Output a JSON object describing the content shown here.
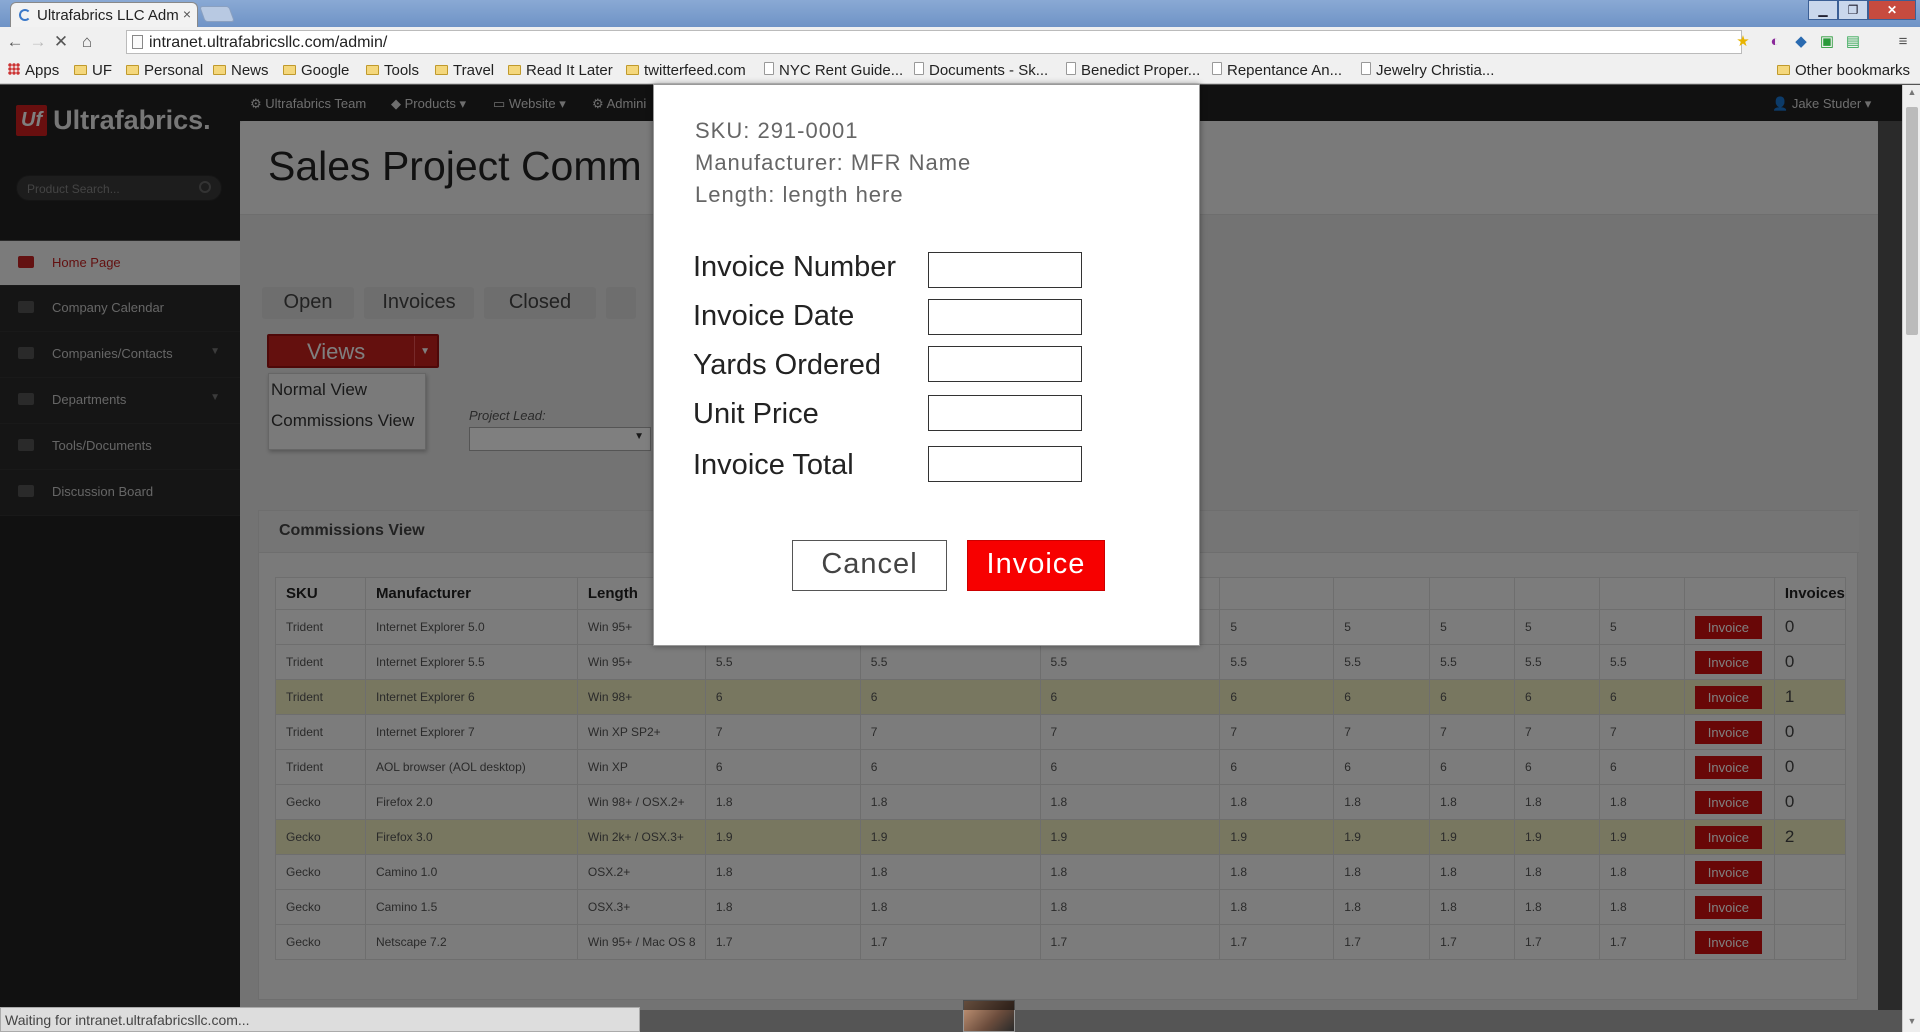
{
  "browser": {
    "tab_title": "Ultrafabrics LLC Adm",
    "url": "intranet.ultrafabricsllc.com/admin/",
    "bookmarks": [
      "Apps",
      "UF",
      "Personal",
      "News",
      "Google",
      "Tools",
      "Travel",
      "Read It Later",
      "twitterfeed.com",
      "NYC Rent Guide...",
      "Documents - Sk...",
      "Benedict Proper...",
      "Repentance An...",
      "Jewelry Christia..."
    ],
    "other_bookmarks": "Other bookmarks",
    "status": "Waiting for intranet.ultrafabricsllc.com..."
  },
  "topnav": {
    "items": [
      "Ultrafabrics Team",
      "Products",
      "Website",
      "Admini"
    ],
    "user": "Jake Studer"
  },
  "sidebar": {
    "logo_mark": "Uf",
    "logo_text": "Ultrafabrics.",
    "search_placeholder": "Product Search...",
    "items": [
      {
        "label": "Home Page"
      },
      {
        "label": "Company Calendar"
      },
      {
        "label": "Companies/Contacts"
      },
      {
        "label": "Departments"
      },
      {
        "label": "Tools/Documents"
      },
      {
        "label": "Discussion Board"
      }
    ]
  },
  "main": {
    "title": "Sales Project Comm",
    "tabs": [
      "Open",
      "Invoices",
      "Closed"
    ],
    "views_button": "Views",
    "views_menu": [
      "Normal View",
      "Commissions View"
    ],
    "project_lead_label": "Project Lead:",
    "panel_title": "Commissions View"
  },
  "table": {
    "headers": [
      "SKU",
      "Manufacturer",
      "Length",
      "",
      "",
      "",
      "",
      "",
      "",
      "",
      "",
      "",
      "Invoices"
    ],
    "invoice_label": "Invoice",
    "rows": [
      {
        "sku": "Trident",
        "mfr": "Internet Explorer 5.0",
        "len": "Win 95+",
        "v": "5",
        "count": "0",
        "hl": false
      },
      {
        "sku": "Trident",
        "mfr": "Internet Explorer 5.5",
        "len": "Win 95+",
        "v": "5.5",
        "count": "0",
        "hl": false
      },
      {
        "sku": "Trident",
        "mfr": "Internet Explorer 6",
        "len": "Win 98+",
        "v": "6",
        "count": "1",
        "hl": true
      },
      {
        "sku": "Trident",
        "mfr": "Internet Explorer 7",
        "len": "Win XP SP2+",
        "v": "7",
        "count": "0",
        "hl": false
      },
      {
        "sku": "Trident",
        "mfr": "AOL browser (AOL desktop)",
        "len": "Win XP",
        "v": "6",
        "count": "0",
        "hl": false
      },
      {
        "sku": "Gecko",
        "mfr": "Firefox 2.0",
        "len": "Win 98+ / OSX.2+",
        "v": "1.8",
        "count": "0",
        "hl": false
      },
      {
        "sku": "Gecko",
        "mfr": "Firefox 3.0",
        "len": "Win 2k+ / OSX.3+",
        "v": "1.9",
        "count": "2",
        "hl": true
      },
      {
        "sku": "Gecko",
        "mfr": "Camino 1.0",
        "len": "OSX.2+",
        "v": "1.8",
        "count": "",
        "hl": false
      },
      {
        "sku": "Gecko",
        "mfr": "Camino 1.5",
        "len": "OSX.3+",
        "v": "1.8",
        "count": "",
        "hl": false
      },
      {
        "sku": "Gecko",
        "mfr": "Netscape 7.2",
        "len": "Win 95+ / Mac OS 8",
        "v": "1.7",
        "count": "",
        "hl": false
      }
    ]
  },
  "modal": {
    "sku": "SKU: 291-0001",
    "manufacturer": "Manufacturer: MFR Name",
    "length": "Length: length here",
    "fields": [
      "Invoice Number",
      "Invoice Date",
      "Yards Ordered",
      "Unit Price",
      "Invoice Total"
    ],
    "cancel": "Cancel",
    "submit": "Invoice"
  },
  "colors": {
    "brand_red": "#d01f1f",
    "invoice_red": "#f70000",
    "highlight_row": "#f0efc1"
  }
}
